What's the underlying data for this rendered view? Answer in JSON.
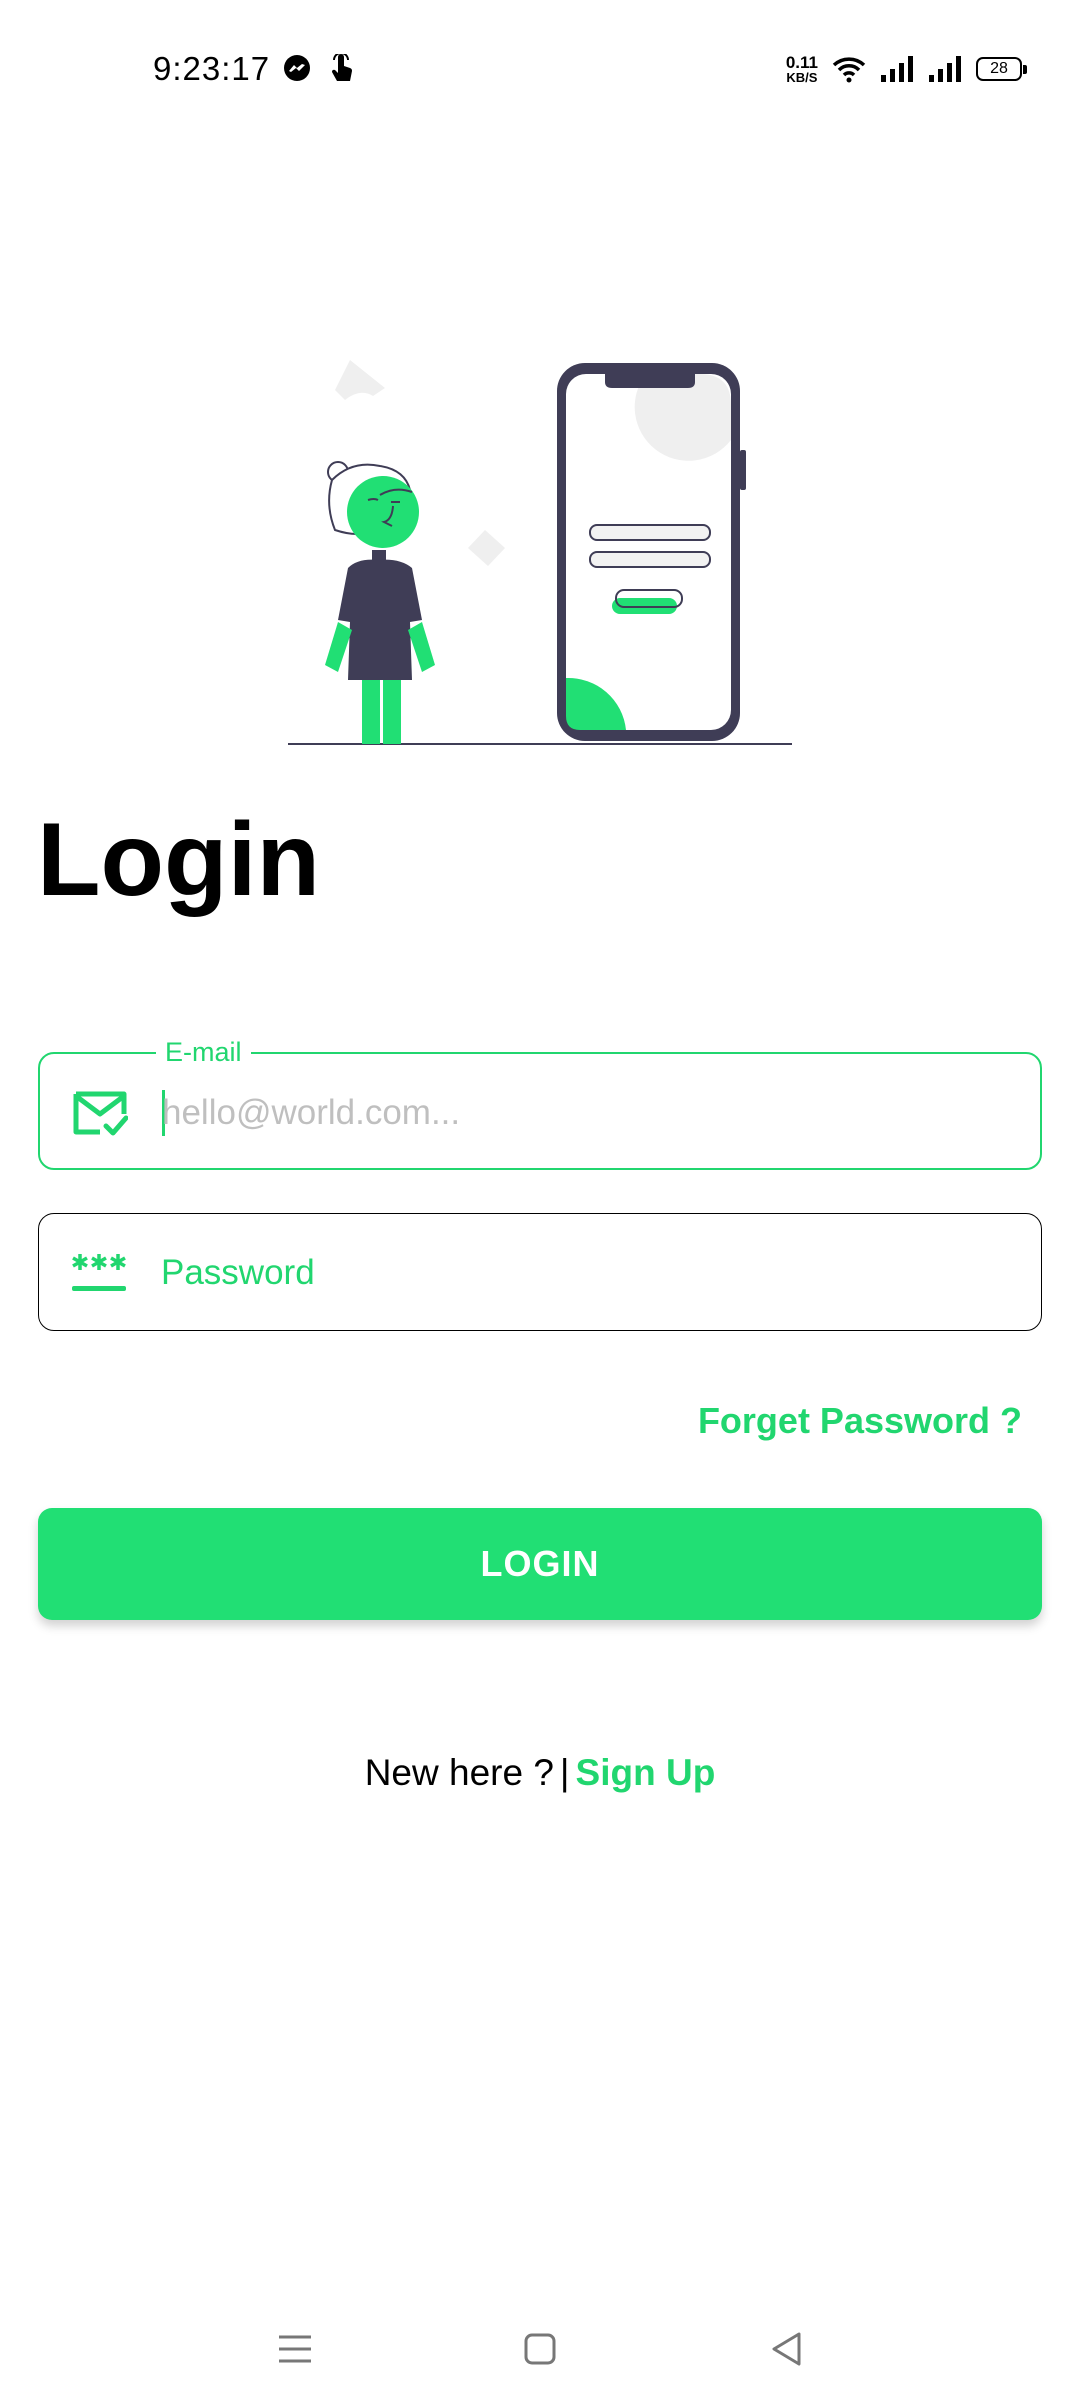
{
  "status_bar": {
    "time": "9:23:17",
    "net_speed_value": "0.11",
    "net_speed_unit": "KB/S",
    "battery": "28",
    "left_icons": [
      "messenger-icon",
      "touch-hand-icon"
    ],
    "right_icons": [
      "wifi-icon",
      "signal-icon",
      "signal-icon",
      "battery-icon"
    ]
  },
  "page": {
    "title": "Login"
  },
  "email": {
    "label": "E-mail",
    "placeholder": "hello@world.com...",
    "value": "",
    "icon": "mail-check-icon"
  },
  "password": {
    "placeholder": "Password",
    "value": "",
    "icon": "password-dots-icon"
  },
  "forget_password": "Forget Password ?",
  "login_button": "LOGIN",
  "signup": {
    "question": "New here ?",
    "separator": "|",
    "link": "Sign Up"
  },
  "nav": {
    "icons": [
      "menu-icon",
      "home-icon",
      "back-icon"
    ]
  },
  "colors": {
    "accent": "#21D66F",
    "button": "#21DF74",
    "dark": "#3F3D56"
  }
}
